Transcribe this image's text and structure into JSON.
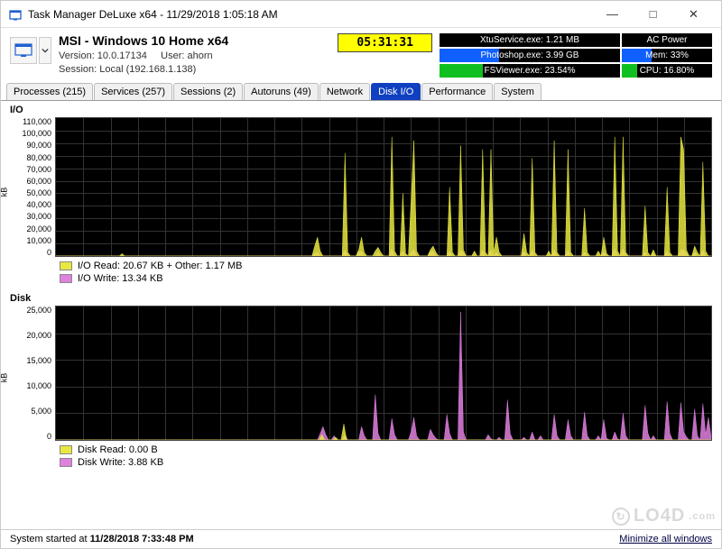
{
  "window": {
    "title": "Task Manager DeLuxe x64 - 11/29/2018 1:05:18 AM"
  },
  "header": {
    "system_title": "MSI - Windows 10 Home x64",
    "version_line": "Version: 10.0.17134",
    "user_label": "User: ahorn",
    "session_line": "Session: Local (192.168.1.138)",
    "timer": "05:31:31"
  },
  "status": {
    "rows": [
      {
        "left_text": "XtuService.exe: 1.21 MB",
        "left_bar": 0,
        "left_color": "#3030a0",
        "right_text": "AC Power",
        "right_bar": 0,
        "right_color": "#3030a0"
      },
      {
        "left_text": "Photoshop.exe: 3.99 GB",
        "left_bar": 33,
        "left_color": "#1060ff",
        "right_text": "Mem: 33%",
        "right_bar": 33,
        "right_color": "#1060ff"
      },
      {
        "left_text": "FSViewer.exe: 23.54%",
        "left_bar": 24,
        "left_color": "#10c020",
        "right_text": "CPU: 16.80%",
        "right_bar": 17,
        "right_color": "#10c020"
      }
    ]
  },
  "tabs": [
    {
      "label": "Processes (215)",
      "active": false
    },
    {
      "label": "Services (257)",
      "active": false
    },
    {
      "label": "Sessions (2)",
      "active": false
    },
    {
      "label": "Autoruns (49)",
      "active": false
    },
    {
      "label": "Network",
      "active": false
    },
    {
      "label": "Disk I/O",
      "active": true
    },
    {
      "label": "Performance",
      "active": false
    },
    {
      "label": "System",
      "active": false
    }
  ],
  "chart_io": {
    "title": "I/O",
    "unit": "kB",
    "y_ticks": [
      "110,000",
      "100,000",
      "90,000",
      "80,000",
      "70,000",
      "60,000",
      "50,000",
      "40,000",
      "30,000",
      "20,000",
      "10,000",
      "0"
    ],
    "legend": [
      {
        "color": "#e8e840",
        "label": "I/O Read: 20.67 KB + Other: 1.17 MB"
      },
      {
        "color": "#e080e0",
        "label": "I/O Write: 13.34 KB"
      }
    ]
  },
  "chart_disk": {
    "title": "Disk",
    "unit": "kB",
    "y_ticks": [
      "25,000",
      "20,000",
      "15,000",
      "10,000",
      "5,000",
      "0"
    ],
    "legend": [
      {
        "color": "#e8e840",
        "label": "Disk Read: 0.00 B"
      },
      {
        "color": "#e080e0",
        "label": "Disk Write: 3.88 KB"
      }
    ]
  },
  "footer": {
    "started": "System started at ",
    "started_bold": "11/28/2018 7:33:48 PM",
    "minimize": "Minimize all windows"
  },
  "watermark": "LO4D",
  "chart_data": [
    {
      "type": "area",
      "title": "I/O",
      "ylabel": "kB",
      "ylim": [
        0,
        110000
      ],
      "x_range": [
        0,
        240
      ],
      "series": [
        {
          "name": "I/O Read + Other",
          "color": "#e8e840",
          "values": [
            0,
            0,
            0,
            0,
            0,
            0,
            0,
            0,
            0,
            0,
            0,
            0,
            0,
            0,
            0,
            0,
            0,
            0,
            0,
            0,
            0,
            0,
            0,
            0,
            2000,
            0,
            0,
            0,
            0,
            0,
            0,
            0,
            0,
            0,
            0,
            0,
            0,
            0,
            0,
            0,
            0,
            0,
            0,
            0,
            0,
            0,
            0,
            0,
            0,
            0,
            0,
            0,
            0,
            0,
            0,
            0,
            0,
            0,
            0,
            0,
            0,
            0,
            0,
            0,
            0,
            0,
            0,
            0,
            0,
            0,
            0,
            0,
            0,
            0,
            0,
            0,
            0,
            0,
            0,
            0,
            0,
            0,
            0,
            0,
            0,
            0,
            0,
            0,
            0,
            0,
            0,
            0,
            0,
            0,
            8000,
            15000,
            4000,
            0,
            0,
            0,
            0,
            0,
            0,
            0,
            0,
            82000,
            3000,
            0,
            0,
            0,
            5000,
            15000,
            3000,
            0,
            0,
            0,
            4000,
            7000,
            3000,
            0,
            0,
            0,
            95000,
            4000,
            0,
            0,
            50000,
            2000,
            0,
            44000,
            92000,
            4000,
            0,
            0,
            0,
            0,
            5000,
            8000,
            3000,
            0,
            0,
            0,
            0,
            55000,
            3000,
            0,
            0,
            88000,
            5000,
            0,
            0,
            0,
            4000,
            0,
            0,
            85000,
            3000,
            0,
            85000,
            3000,
            15000,
            3000,
            0,
            0,
            0,
            0,
            0,
            0,
            0,
            0,
            18000,
            3000,
            0,
            78000,
            3000,
            0,
            0,
            0,
            0,
            4000,
            0,
            92000,
            3000,
            0,
            0,
            0,
            85000,
            3000,
            0,
            0,
            0,
            0,
            38000,
            3000,
            0,
            0,
            0,
            4000,
            0,
            15000,
            2000,
            0,
            0,
            95000,
            4000,
            0,
            95000,
            3000,
            0,
            0,
            0,
            0,
            0,
            0,
            40000,
            3000,
            0,
            5000,
            0,
            0,
            0,
            0,
            55000,
            3000,
            0,
            0,
            0,
            95000,
            85000,
            5000,
            0,
            0,
            8000,
            3000,
            0,
            75000,
            4000,
            0,
            0
          ]
        },
        {
          "name": "I/O Write",
          "color": "#e080e0",
          "values": [
            0,
            0,
            0,
            0,
            0,
            0,
            0,
            0,
            0,
            0,
            0,
            0,
            0,
            0,
            0,
            0,
            0,
            0,
            0,
            0,
            0,
            0,
            0,
            0,
            0,
            0,
            0,
            0,
            0,
            0,
            0,
            0,
            0,
            0,
            0,
            0,
            0,
            0,
            0,
            0,
            0,
            0,
            0,
            0,
            0,
            0,
            0,
            0,
            0,
            0,
            0,
            0,
            0,
            0,
            0,
            0,
            0,
            0,
            0,
            0,
            0,
            0,
            0,
            0,
            0,
            0,
            0,
            0,
            0,
            0,
            0,
            0,
            0,
            0,
            0,
            0,
            0,
            0,
            0,
            0,
            0,
            0,
            0,
            0,
            0,
            0,
            0,
            0,
            0,
            0,
            0,
            0,
            0,
            0,
            2000,
            3000,
            0,
            0,
            0,
            0,
            0,
            0,
            0,
            0,
            0,
            5000,
            0,
            0,
            0,
            0,
            3000,
            4000,
            0,
            0,
            0,
            0,
            0,
            3000,
            0,
            0,
            0,
            0,
            6000,
            0,
            0,
            0,
            4000,
            0,
            0,
            3000,
            5000,
            0,
            0,
            0,
            0,
            0,
            3000,
            4000,
            0,
            0,
            0,
            0,
            0,
            4000,
            0,
            0,
            0,
            5000,
            2000,
            0,
            0,
            0,
            0,
            0,
            0,
            5000,
            0,
            0,
            5000,
            0,
            3000,
            0,
            0,
            0,
            0,
            0,
            0,
            0,
            0,
            0,
            4000,
            0,
            0,
            5000,
            0,
            0,
            0,
            0,
            0,
            0,
            0,
            5000,
            0,
            0,
            0,
            0,
            5000,
            0,
            0,
            0,
            0,
            0,
            3000,
            0,
            0,
            0,
            0,
            0,
            0,
            3000,
            0,
            0,
            0,
            6000,
            0,
            0,
            6000,
            0,
            0,
            0,
            0,
            0,
            0,
            0,
            3000,
            0,
            0,
            2000,
            0,
            0,
            0,
            0,
            4000,
            0,
            0,
            0,
            0,
            5000,
            5000,
            2000,
            0,
            0,
            3000,
            0,
            0,
            5000,
            0,
            0,
            0
          ]
        }
      ]
    },
    {
      "type": "area",
      "title": "Disk",
      "ylabel": "kB",
      "ylim": [
        0,
        25000
      ],
      "x_range": [
        0,
        240
      ],
      "series": [
        {
          "name": "Disk Read",
          "color": "#e8e840",
          "values": [
            0,
            0,
            0,
            0,
            0,
            0,
            0,
            0,
            0,
            0,
            0,
            0,
            0,
            0,
            0,
            0,
            0,
            0,
            0,
            0,
            0,
            0,
            0,
            0,
            0,
            0,
            0,
            0,
            0,
            0,
            0,
            0,
            0,
            0,
            0,
            0,
            0,
            0,
            0,
            0,
            0,
            0,
            0,
            0,
            0,
            0,
            0,
            0,
            0,
            0,
            0,
            0,
            0,
            0,
            0,
            0,
            0,
            0,
            0,
            0,
            0,
            0,
            0,
            0,
            0,
            0,
            0,
            0,
            0,
            0,
            0,
            0,
            0,
            0,
            0,
            0,
            0,
            0,
            0,
            0,
            0,
            0,
            0,
            0,
            0,
            0,
            0,
            0,
            0,
            0,
            0,
            0,
            0,
            0,
            0,
            0,
            0,
            1000,
            0,
            0,
            0,
            0,
            500,
            0,
            0,
            3000,
            0,
            0,
            0,
            0,
            0,
            0,
            0,
            0,
            0,
            0,
            0,
            0,
            0,
            0,
            0,
            0,
            0,
            0,
            0,
            0,
            0,
            0,
            0,
            0,
            0,
            0,
            0,
            0,
            0,
            0,
            0,
            0,
            0,
            0,
            0,
            0,
            0,
            0,
            0,
            0,
            0,
            0,
            0,
            0,
            0,
            0,
            0,
            0,
            0,
            0,
            0,
            0,
            0,
            0,
            0,
            0,
            0,
            0,
            0,
            0,
            0,
            0,
            0,
            0,
            0,
            0,
            0,
            0,
            0,
            0,
            0,
            0,
            0,
            0,
            0,
            0,
            0,
            0,
            0,
            0,
            0,
            0,
            0,
            0,
            0,
            0,
            0,
            0,
            0,
            0,
            0,
            0,
            0,
            0,
            0,
            0,
            0,
            0,
            0,
            0,
            0,
            0,
            0,
            0,
            0,
            0,
            0,
            0,
            0,
            0,
            0,
            0,
            0,
            0,
            0,
            0,
            0,
            0,
            0,
            0,
            0,
            0,
            0,
            0,
            0,
            0,
            0,
            0,
            0,
            0,
            0,
            0,
            0,
            0
          ]
        },
        {
          "name": "Disk Write",
          "color": "#e080e0",
          "values": [
            0,
            0,
            0,
            0,
            0,
            0,
            0,
            0,
            0,
            0,
            0,
            0,
            0,
            0,
            0,
            0,
            0,
            0,
            0,
            0,
            0,
            0,
            0,
            0,
            0,
            0,
            0,
            0,
            0,
            0,
            0,
            0,
            0,
            0,
            0,
            0,
            0,
            0,
            0,
            0,
            0,
            0,
            0,
            0,
            0,
            0,
            0,
            0,
            0,
            0,
            0,
            0,
            0,
            0,
            0,
            0,
            0,
            0,
            0,
            0,
            0,
            0,
            0,
            0,
            0,
            0,
            0,
            0,
            0,
            0,
            0,
            0,
            0,
            0,
            0,
            0,
            0,
            0,
            0,
            0,
            0,
            0,
            0,
            0,
            0,
            0,
            0,
            0,
            0,
            0,
            0,
            0,
            0,
            0,
            0,
            0,
            1200,
            2500,
            1000,
            0,
            0,
            800,
            0,
            0,
            0,
            1000,
            0,
            0,
            0,
            0,
            0,
            2500,
            800,
            0,
            0,
            0,
            8500,
            1200,
            0,
            0,
            0,
            0,
            4000,
            1000,
            0,
            0,
            0,
            0,
            0,
            1500,
            4200,
            800,
            0,
            0,
            0,
            0,
            2000,
            1000,
            300,
            0,
            0,
            0,
            4800,
            1200,
            0,
            0,
            0,
            24000,
            1500,
            0,
            0,
            0,
            0,
            0,
            0,
            0,
            0,
            1000,
            200,
            0,
            0,
            500,
            0,
            0,
            7500,
            1200,
            0,
            0,
            0,
            0,
            500,
            0,
            0,
            1500,
            0,
            0,
            800,
            0,
            0,
            0,
            0,
            4800,
            800,
            0,
            0,
            0,
            3800,
            800,
            0,
            0,
            0,
            0,
            5200,
            800,
            0,
            0,
            0,
            800,
            0,
            3800,
            300,
            0,
            0,
            1500,
            200,
            0,
            5000,
            800,
            0,
            0,
            0,
            0,
            0,
            0,
            6500,
            1300,
            0,
            800,
            0,
            0,
            0,
            0,
            7200,
            1200,
            0,
            0,
            0,
            7000,
            1500,
            600,
            0,
            0,
            5800,
            800,
            0,
            6800,
            1000,
            4200,
            500
          ]
        }
      ]
    }
  ]
}
